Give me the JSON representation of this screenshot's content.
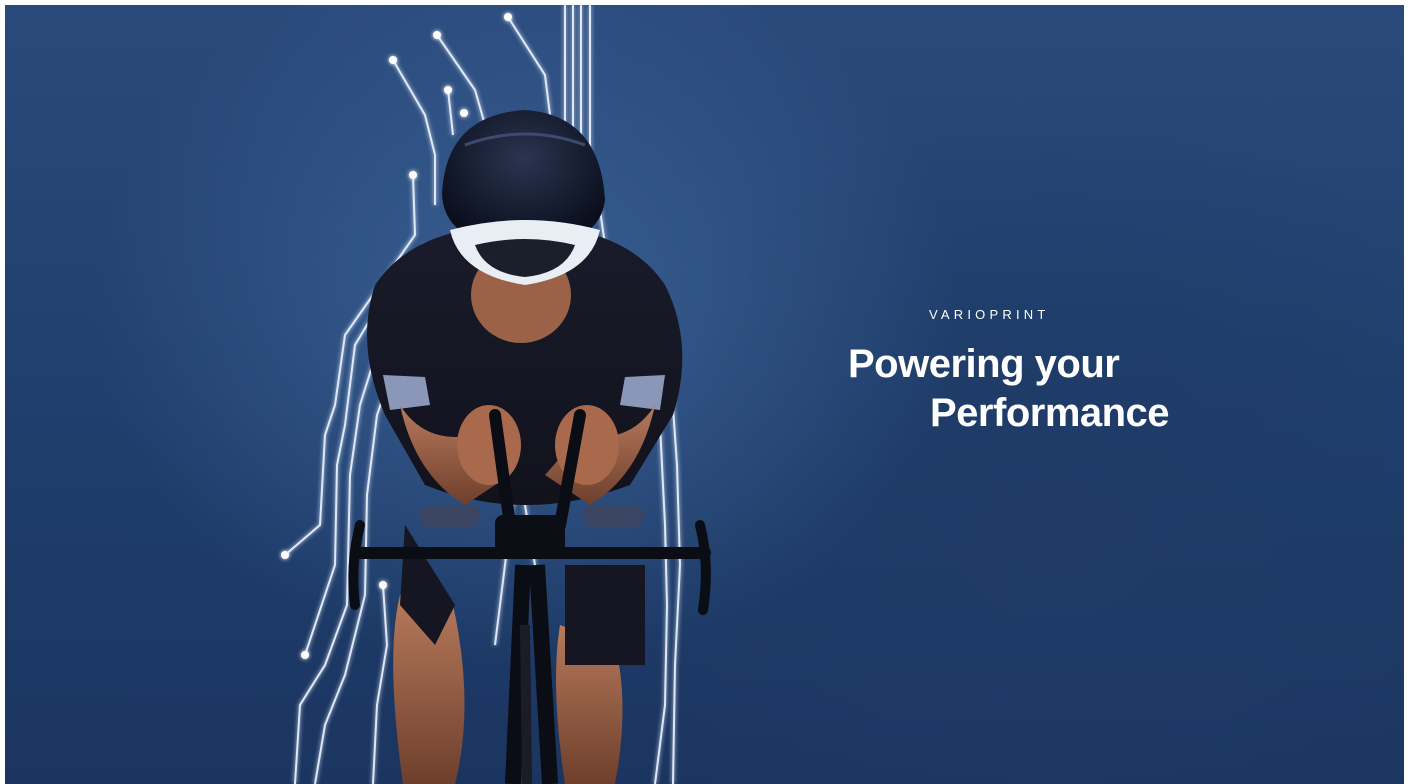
{
  "brand": {
    "name": "VARIOPRINT"
  },
  "headline": {
    "line1": "Powering your",
    "line2": "Performance"
  },
  "colors": {
    "background_dark": "#1b3560",
    "background_light": "#3a5f93",
    "text": "#ffffff",
    "circuit": "#e8f1ff"
  },
  "image": {
    "subject": "cyclist-with-circuit-lines"
  }
}
